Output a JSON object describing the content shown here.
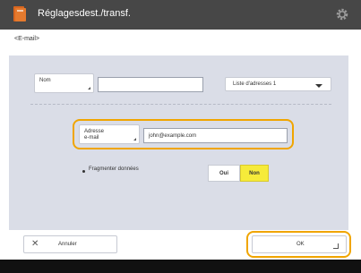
{
  "window": {
    "title": "Réglagesdest./transf.",
    "gear_icon": "gear-icon",
    "app_icon": "address-book-icon",
    "titlebar_color": "#474747"
  },
  "breadcrumb": "<E-mail>",
  "form": {
    "name_button_label": "Nom",
    "name_value": "",
    "address_list": {
      "selected": "Liste d'adresses 1"
    },
    "email_button_label_line1": "Adresse",
    "email_button_label_line2": "e-mail",
    "email_value": "john@example.com",
    "fragment_label": "Fragmenter données",
    "fragment_options": [
      "Oui",
      "Non"
    ],
    "fragment_selected": "Non"
  },
  "footer": {
    "cancel_label": "Annuler",
    "ok_label": "OK"
  },
  "colors": {
    "highlight": "#f0a500",
    "selected_toggle": "#f6eb3a",
    "panel": "#dadde7"
  }
}
